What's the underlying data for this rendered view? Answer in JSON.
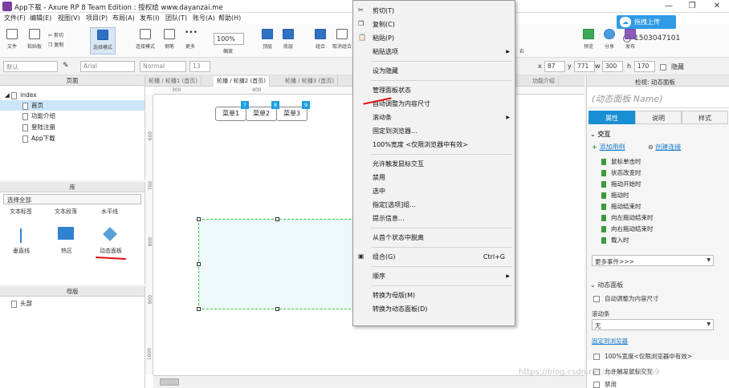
{
  "window": {
    "title": "App下载 - Axure RP 8 Team Edition : 授权给 www.dayanzai.me"
  },
  "menubar": [
    "文件(F)",
    "编辑(E)",
    "视图(V)",
    "项目(P)",
    "布局(A)",
    "发布(I)",
    "团队(T)",
    "账号(A)",
    "帮助(H)"
  ],
  "toolbar": {
    "file": "文件",
    "clipboard": "粘贴板",
    "cut": "剪切",
    "copy": "复制",
    "select_mode": "选择模式",
    "connect_mode": "连接模式",
    "pen": "钢笔",
    "more": "更多",
    "zoom_value": "100%",
    "zoom": "缩放",
    "top": "顶层",
    "bottom": "底层",
    "group": "组合",
    "ungroup": "取消组合",
    "right": "右",
    "preview": "预览",
    "share": "分享",
    "publish": "发布",
    "upload": "拖拽上传",
    "user_id": "1503047101"
  },
  "formatbar": {
    "style": "默认",
    "font": "Arial",
    "weight": "Normal",
    "size": "13",
    "x_label": "x",
    "x": "87",
    "y_label": "y",
    "y": "771",
    "w_label": "w",
    "w": "300",
    "h_label": "h",
    "h": "170",
    "hidden": "隐藏"
  },
  "pages_panel": {
    "title": "页面",
    "root": "index",
    "pages": [
      "首页",
      "功能介绍",
      "登陆注册",
      "App下载"
    ]
  },
  "library_panel": {
    "title": "库",
    "dropdown": "选择全部",
    "row1": [
      "文本标签",
      "文本段落",
      "水平线"
    ],
    "row2": [
      "垂直线",
      "热区",
      "动态面板"
    ]
  },
  "masters_panel": {
    "title": "母版",
    "items": [
      "头部"
    ]
  },
  "tabs": [
    "轮播 / 轮播1 (首页)",
    "轮播 / 轮播2 (首页)",
    "轮播 / 轮播3 (首页)",
    "功能介绍"
  ],
  "canvas": {
    "menu_buttons": [
      {
        "label": "菜单1",
        "badge": "7"
      },
      {
        "label": "菜单2",
        "badge": "8"
      },
      {
        "label": "菜单3",
        "badge": "9"
      }
    ],
    "ruler_h": [
      "300",
      "400"
    ],
    "ruler_v": [
      "600",
      "700",
      "800",
      "900",
      "1000"
    ]
  },
  "context_menu": [
    {
      "label": "剪切(T)",
      "icon": "scissors-icon"
    },
    {
      "label": "复制(C)",
      "icon": "copy-icon"
    },
    {
      "label": "粘贴(P)",
      "icon": "paste-icon"
    },
    {
      "label": "粘贴选项",
      "submenu": true
    },
    {
      "sep": true
    },
    {
      "label": "设为隐藏"
    },
    {
      "sep": true
    },
    {
      "label": "管理面板状态"
    },
    {
      "label": "自动调整为内容尺寸"
    },
    {
      "label": "滚动条",
      "submenu": true
    },
    {
      "label": "固定到浏览器..."
    },
    {
      "label": "100%宽度 <仅限浏览器中有效>"
    },
    {
      "sep": true
    },
    {
      "label": "允许触发鼠标交互"
    },
    {
      "label": "禁用"
    },
    {
      "label": "选中"
    },
    {
      "label": "指定[选项]组..."
    },
    {
      "label": "提示信息..."
    },
    {
      "sep": true
    },
    {
      "label": "从首个状态中脱离"
    },
    {
      "sep": true
    },
    {
      "label": "组合(G)",
      "shortcut": "Ctrl+G",
      "icon": "group-icon"
    },
    {
      "sep": true
    },
    {
      "label": "顺序",
      "submenu": true
    },
    {
      "sep": true
    },
    {
      "label": "转换为母版(M)"
    },
    {
      "label": "转换为动态面板(D)"
    }
  ],
  "inspector": {
    "header": "检视: 动态面板",
    "name_placeholder": "(动态面板 Name)",
    "tabs": [
      "属性",
      "说明",
      "样式"
    ],
    "section_interaction": "交互",
    "add_case": "添加用例",
    "create_link": "创建连接",
    "events": [
      "鼠标单击时",
      "状态改变时",
      "拖动开始时",
      "拖动时",
      "拖动结束时",
      "向左拖动结束时",
      "向右拖动结束时",
      "载入时"
    ],
    "more_events": "更多事件>>>",
    "section_panel": "动态面板",
    "autofit": "自动调整为内容尺寸",
    "scrollbar_label": "滚动条",
    "scrollbar_value": "无",
    "pin_browser": "固定到浏览器",
    "full_width": "100%宽度<仅限浏览器中有效>",
    "allow_trigger": "允许触发鼠标交互",
    "disable": "禁用"
  },
  "watermark": "https://blog.csdn.net/qq_40959369"
}
